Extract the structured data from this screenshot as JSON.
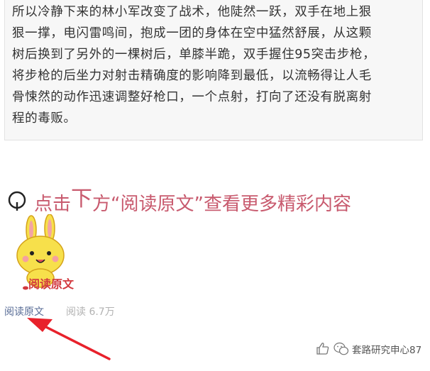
{
  "article": {
    "paragraph": "所以冷静下来的林小军改变了战术，他陡然一跃，双手在地上狠\n狠一撑，电闪雷鸣间，抱成一团的身体在空中猛然舒展，从这颗\n树后换到了另外的一棵树后，单膝半跪，双手握住95突击步枪，\n将步枪的后坐力对射击精确度的影响降到最低，以流畅得让人毛\n骨悚然的动作迅速调整好枪口，一个点射，打向了还没有脱离射\n程的毒贩。"
  },
  "promo": {
    "prefix": "点击",
    "highlight": "下",
    "suffix": "方“阅读原文”查看更多精彩内容",
    "mascot_label": "阅读原文",
    "text_color": "#c85a6e",
    "mascot_color": "#f7e04b"
  },
  "footer": {
    "read_more": "阅读原文",
    "reads": "阅读 6.7万",
    "watermark": "套路研究申心87",
    "link_color": "#576b95",
    "arrow_color": "#e8212b"
  }
}
